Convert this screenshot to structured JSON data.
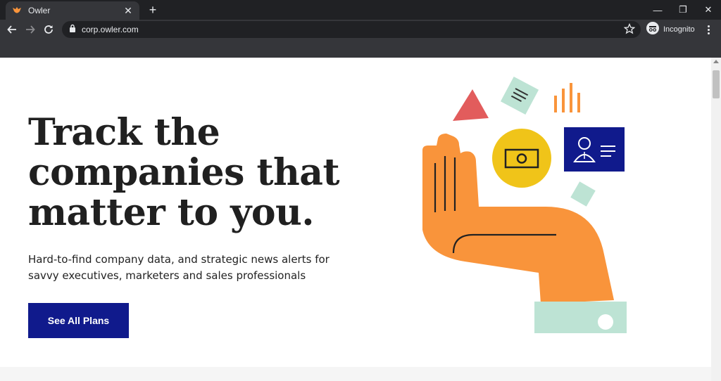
{
  "browser": {
    "tab": {
      "title": "Owler",
      "close": "✕"
    },
    "new_tab": "+",
    "window": {
      "minimize": "—",
      "restore": "❐",
      "close": "✕"
    },
    "url": "corp.owler.com",
    "profile_label": "Incognito"
  },
  "hero": {
    "title": "Track the companies that matter to you.",
    "subtitle": "Hard-to-find company data, and strategic news alerts for savvy executives, marketers and sales professionals",
    "cta_label": "See All Plans"
  },
  "colors": {
    "brand_blue": "#101a8c",
    "orange": "#f9943b",
    "yellow": "#f0c419",
    "red": "#e25c5c",
    "mint": "#bde3d4"
  },
  "icons": [
    "owler-favicon",
    "back-icon",
    "forward-icon",
    "reload-icon",
    "lock-icon",
    "star-icon",
    "incognito-icon",
    "menu-icon"
  ]
}
